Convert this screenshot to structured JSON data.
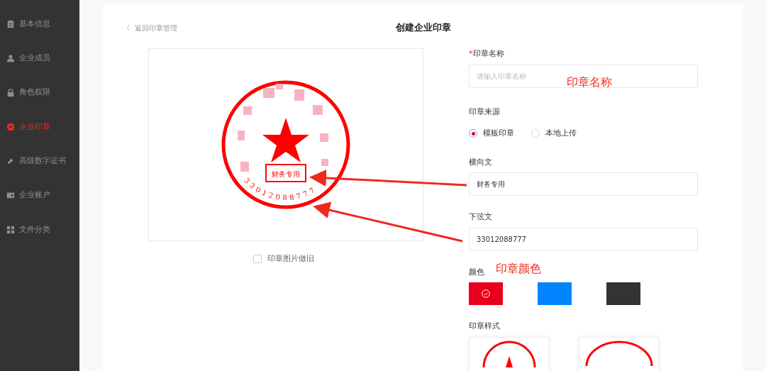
{
  "sidebar": {
    "items": [
      {
        "label": "基本信息",
        "selected": false
      },
      {
        "label": "企业成员",
        "selected": false
      },
      {
        "label": "角色权限",
        "selected": false
      },
      {
        "label": "企业印章",
        "selected": true
      },
      {
        "label": "高级数字证书",
        "selected": false
      },
      {
        "label": "企业账户",
        "selected": false
      },
      {
        "label": "文件分类",
        "selected": false
      }
    ]
  },
  "header": {
    "back_link": "返回印章管理",
    "title": "创建企业印章"
  },
  "preview": {
    "seal": {
      "horizontal_text": "财务专用",
      "bottom_text": "33012088777"
    },
    "aged_option": {
      "label": "印章图片做旧",
      "checked": false
    }
  },
  "form": {
    "name": {
      "label": "印章名称",
      "required_mark": "*",
      "placeholder": "请输入印章名称"
    },
    "source": {
      "label": "印章来源",
      "options": [
        {
          "label": "模板印章",
          "selected": true
        },
        {
          "label": "本地上传",
          "selected": false
        }
      ]
    },
    "horizontal": {
      "label": "横向文",
      "value": "财务专用"
    },
    "bottom": {
      "label": "下弦文",
      "value": "33012088777"
    },
    "color": {
      "label": "颜色",
      "swatches": [
        {
          "color": "#e8001c",
          "selected": true
        },
        {
          "color": "#0084ff",
          "selected": false
        },
        {
          "color": "#333333",
          "selected": false
        }
      ]
    },
    "style": {
      "label": "印章样式"
    }
  },
  "annotations": [
    {
      "text": "印章名称"
    },
    {
      "text": "印章颜色"
    }
  ]
}
